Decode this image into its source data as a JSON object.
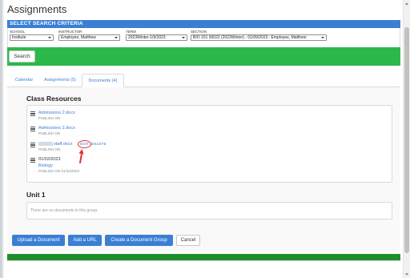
{
  "page": {
    "title": "Assignments"
  },
  "criteria": {
    "header": "SELECT SEARCH CRITERIA",
    "school": {
      "label": "SCHOOL",
      "value": "Institute"
    },
    "instructor": {
      "label": "INSTRUCTOR",
      "value": "Employee, Matthew"
    },
    "term": {
      "label": "TERM",
      "value": "2023Winter-1/9/2023"
    },
    "section": {
      "label": "SECTION",
      "value": "BIO 101 00022 (2023Winter) - 01/09/2023 : Employee, Matthew"
    },
    "search_label": "Search"
  },
  "tabs": [
    {
      "label": "Calendar",
      "active": false
    },
    {
      "label": "Assignments (5)",
      "active": false
    },
    {
      "label": "Documents (4)",
      "active": true
    }
  ],
  "class_resources": {
    "title": "Class Resources",
    "items": [
      {
        "name": "Admissions 2.docx",
        "sub": "PUBLISH ON"
      },
      {
        "name": "Admissions 2.docx",
        "sub": "PUBLISH ON"
      },
      {
        "name": "staff.docx",
        "sub": "PUBLISH ON",
        "edit": "EDIT",
        "delete": "DELETE"
      },
      {
        "date": "01/02/2023",
        "name": "Biology",
        "sub": "PUBLISH ON 01/10/2023"
      }
    ]
  },
  "unit": {
    "title": "Unit 1",
    "empty_text": "There are no documents in this group."
  },
  "actions": {
    "upload": "Upload a Document",
    "add_url": "Add a URL",
    "create_group": "Create a Document Group",
    "cancel": "Cancel"
  },
  "colors": {
    "accent_blue": "#3a7fd4",
    "bar_green": "#2db84a",
    "footer_green": "#1f8f2b",
    "annotation_red": "#e03030"
  }
}
